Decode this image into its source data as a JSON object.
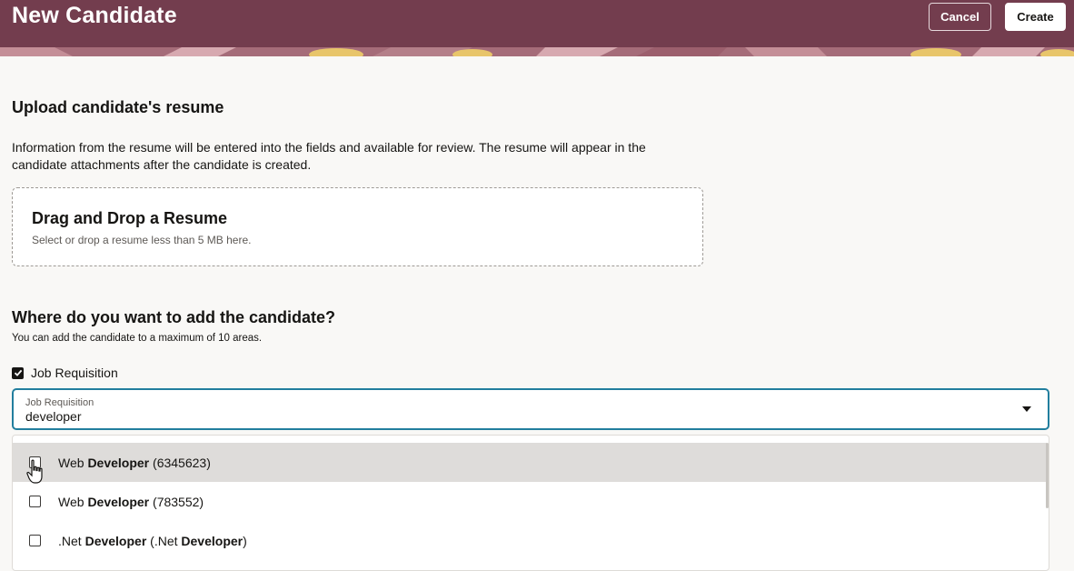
{
  "header": {
    "title": "New Candidate",
    "cancel_label": "Cancel",
    "create_label": "Create",
    "bg_color": "#733d4e"
  },
  "upload": {
    "title": "Upload candidate's resume",
    "description": "Information from the resume will be entered into the fields and available for review. The resume will appear in the candidate attachments after the candidate is created.",
    "dropzone_title": "Drag and Drop a Resume",
    "dropzone_hint": "Select or drop a resume less than 5 MB here."
  },
  "placement": {
    "title": "Where do you want to add the candidate?",
    "hint": "You can add the candidate to a maximum of 10 areas.",
    "checkbox_label": "Job Requisition",
    "checkbox_checked": true
  },
  "combo": {
    "label": "Job Requisition",
    "value": "developer",
    "accent_color": "#227e9e"
  },
  "options": [
    {
      "pre": "Web ",
      "bold": "Developer",
      "post": " (6345623)",
      "checked": false,
      "hovered": true
    },
    {
      "pre": "Web ",
      "bold": "Developer",
      "post": " (783552)",
      "checked": false,
      "hovered": false
    },
    {
      "pre": ".Net ",
      "bold": "Developer",
      "mid": " (.Net ",
      "bold2": "Developer",
      "post": ")",
      "checked": false,
      "hovered": false
    }
  ],
  "icons": {
    "checkbox": "checkmark-icon",
    "caret": "caret-down-icon",
    "cursor": "hand-pointer-icon"
  }
}
